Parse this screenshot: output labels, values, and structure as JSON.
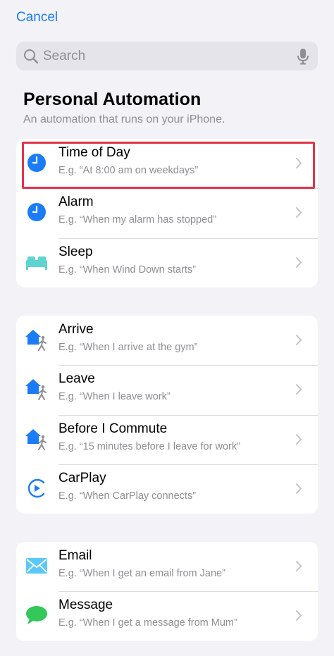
{
  "nav": {
    "cancel_label": "Cancel"
  },
  "search": {
    "placeholder": "Search"
  },
  "header": {
    "title": "Personal Automation",
    "subtitle": "An automation that runs on your iPhone."
  },
  "groups": [
    {
      "items": [
        {
          "label": "Time of Day",
          "desc": "E.g. “At 8:00 am on weekdays”",
          "icon": "clock-icon",
          "highlighted": true
        },
        {
          "label": "Alarm",
          "desc": "E.g. “When my alarm has stopped”",
          "icon": "alarm-clock-icon"
        },
        {
          "label": "Sleep",
          "desc": "E.g. “When Wind Down starts”",
          "icon": "bed-icon"
        }
      ]
    },
    {
      "items": [
        {
          "label": "Arrive",
          "desc": "E.g. “When I arrive at the gym”",
          "icon": "house-walker-icon"
        },
        {
          "label": "Leave",
          "desc": "E.g. “When I leave work”",
          "icon": "house-walker-icon"
        },
        {
          "label": "Before I Commute",
          "desc": "E.g. “15 minutes before I leave for work”",
          "icon": "house-walker-icon"
        },
        {
          "label": "CarPlay",
          "desc": "E.g. “When CarPlay connects”",
          "icon": "carplay-icon"
        }
      ]
    },
    {
      "items": [
        {
          "label": "Email",
          "desc": "E.g. “When I get an email from Jane”",
          "icon": "envelope-icon"
        },
        {
          "label": "Message",
          "desc": "E.g. “When I get a message from Mum”",
          "icon": "message-bubble-icon"
        }
      ]
    }
  ],
  "colors": {
    "accent": "#1a7cf6",
    "background": "#f2f2f7",
    "highlight_border": "#e0344a",
    "sleep_teal": "#5ed3d0",
    "message_green": "#34c759",
    "email_blue": "#5ac8fa"
  }
}
